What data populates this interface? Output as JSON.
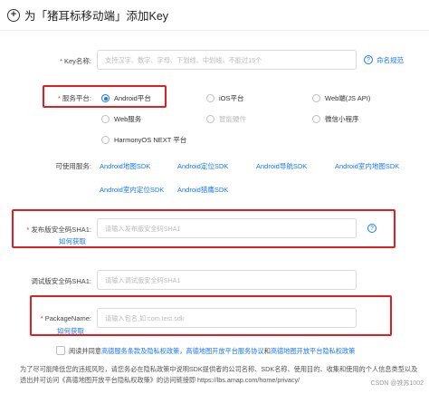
{
  "header": {
    "icon": "plus-circle-icon",
    "title": "为「猪耳标移动端」添加Key"
  },
  "key_name": {
    "label": "Key名称:",
    "placeholder": "支持汉字、数字、字母、下划线、中划线，不能过15个",
    "help_link": "命名规范"
  },
  "platform": {
    "label": "服务平台:",
    "options": [
      {
        "label": "Android平台",
        "selected": true
      },
      {
        "label": "iOS平台",
        "selected": false
      },
      {
        "label": "Web端(JS API)",
        "selected": false
      },
      {
        "label": "Web服务",
        "selected": false
      },
      {
        "label": "智能硬件",
        "selected": false,
        "disabled": true
      },
      {
        "label": "微信小程序",
        "selected": false
      },
      {
        "label": "HarmonyOS NEXT 平台",
        "selected": false
      }
    ]
  },
  "services": {
    "label": "可使用服务:",
    "items": [
      "Android地图SDK",
      "Android定位SDK",
      "Android导航SDK",
      "Android室内地图SDK",
      "Android室内定位SDK",
      "Android猎鹰SDK"
    ]
  },
  "sha1_release": {
    "label": "发布版安全码SHA1:",
    "placeholder": "请输入发布版安全码SHA1",
    "how_link": "如何获取"
  },
  "sha1_debug": {
    "label": "调试版安全码SHA1:",
    "placeholder": "请输入调试版安全码SHA1"
  },
  "package": {
    "label": "PackageName:",
    "placeholder": "请输入包名,如:com.test.sdk",
    "how_link": "如何获取"
  },
  "agreement": {
    "prefix": "阅读并同意",
    "link1": "高德服务条款及隐私权政策",
    "sep1": "，",
    "link2": "高德地图开放平台服务协议",
    "sep2": "和",
    "link3": "高德地图开放平台隐私权政策"
  },
  "note": "为了尽可能降低您的违规风险，请您务必在隐私政策中说明SDK提供者的公司名称、SDK名称、使用目的、收集和使用的个人信息类型以及透出并可访问《高德地图开放平台隐私权政策》的访问链接即 https://lbs.amap.com/home/privacy/",
  "watermark": "CSDN @铁苏1002",
  "colors": {
    "accent": "#1677ff",
    "highlight_box": "#e02020",
    "required": "#f5222d"
  }
}
